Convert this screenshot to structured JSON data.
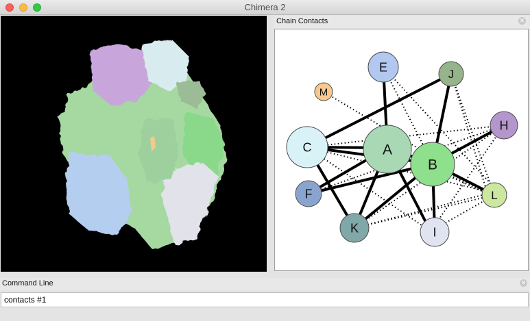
{
  "window": {
    "title": "Chimera 2"
  },
  "chain_contacts": {
    "title": "Chain Contacts",
    "nodes": [
      {
        "label": "A",
        "color": "#a8d8b4"
      },
      {
        "label": "B",
        "color": "#8ee08c"
      },
      {
        "label": "C",
        "color": "#d8f2f8"
      },
      {
        "label": "E",
        "color": "#b2c8f0"
      },
      {
        "label": "F",
        "color": "#8aa4d0"
      },
      {
        "label": "H",
        "color": "#b496cc"
      },
      {
        "label": "I",
        "color": "#e0e4f0"
      },
      {
        "label": "J",
        "color": "#96b48c"
      },
      {
        "label": "K",
        "color": "#80a8a8"
      },
      {
        "label": "L",
        "color": "#cce8a0"
      },
      {
        "label": "M",
        "color": "#f8c88c"
      }
    ]
  },
  "command_line": {
    "title": "Command Line",
    "value": "contacts #1"
  }
}
